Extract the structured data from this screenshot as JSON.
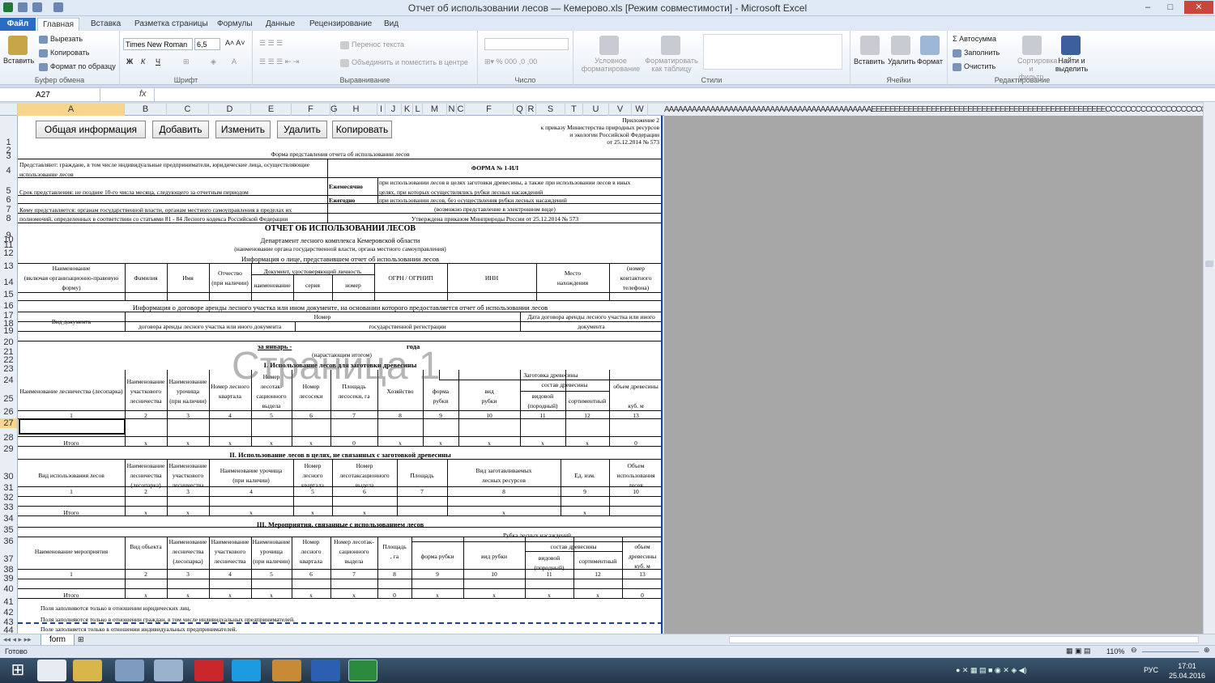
{
  "window": {
    "title": "Отчет об использовании лесов — Кемерово.xls  [Режим совместимости]  -  Microsoft Excel"
  },
  "tabs": [
    "Файл",
    "Главная",
    "Вставка",
    "Разметка страницы",
    "Формулы",
    "Данные",
    "Рецензирование",
    "Вид"
  ],
  "ribbon": {
    "clipboard": {
      "paste": "Вставить",
      "cut": "Вырезать",
      "copy": "Копировать",
      "format_painter": "Формат по образцу",
      "group": "Буфер обмена"
    },
    "font": {
      "name": "Times New Roman",
      "size": "6,5",
      "group": "Шрифт"
    },
    "alignment": {
      "wrap": "Перенос текста",
      "merge": "Объединить и поместить в центре",
      "group": "Выравнивание"
    },
    "number": {
      "group": "Число"
    },
    "styles": {
      "conditional": "Условное форматирование",
      "as_table": "Форматировать как таблицу",
      "group": "Стили"
    },
    "cells": {
      "insert": "Вставить",
      "delete": "Удалить",
      "format": "Формат",
      "group": "Ячейки"
    },
    "editing": {
      "autosum": "Автосумма",
      "fill": "Заполнить",
      "clear": "Очистить",
      "sort": "Сортировка и фильтр",
      "find": "Найти и выделить",
      "group": "Редактирование"
    }
  },
  "formula_bar": {
    "name_box": "A27",
    "fx": "fx",
    "value": ""
  },
  "columns": [
    "A",
    "B",
    "C",
    "D",
    "E",
    "F",
    "G",
    "H",
    "I",
    "J",
    "K",
    "L",
    "M",
    "N",
    "C",
    "F",
    "Q",
    "R",
    "S",
    "T",
    "U",
    "V",
    "W",
    "X"
  ],
  "hatch": "AAAAAAAAAAAAAAAAAAAAAAAAAAAAAAAAAAAAAAAAAAAAAEEEEEEEEEEEEEEEEEEEEEEEEEEEEEEEEEEEEEEEEEEEEEEEEEEECCCCCCCCCCCCCCCCCCCCCCCCCCCCCCCCCCCEEEEEEEEEEEEEEEEEEEEEEEEEEEEE",
  "rows": [
    "1",
    "2",
    "3",
    "4",
    "5",
    "6",
    "7",
    "8",
    "9",
    "10",
    "11",
    "12",
    "13",
    "14",
    "15",
    "16",
    "17",
    "18",
    "19",
    "20",
    "21",
    "22",
    "23",
    "24",
    "25",
    "26",
    "27",
    "28",
    "29",
    "30",
    "31",
    "32",
    "33",
    "34",
    "35",
    "36",
    "37",
    "38",
    "39",
    "40",
    "41",
    "42",
    "43",
    "44"
  ],
  "buttons": [
    "Общая информация",
    "Добавить",
    "Изменить",
    "Удалить",
    "Копировать"
  ],
  "header_right": [
    "Приложение 2",
    "к приказу Министерства природных ресурсов",
    "и экологии Российской Федерации",
    "от 25.12.2014 № 573"
  ],
  "form": {
    "r3": "Форма представления отчета об использовании лесов",
    "r4a": "Представляют: граждане, в том числе индивидуальные предприниматели, юридические лица, осуществляющие",
    "r4b": "использование лесов",
    "r4form": "ФОРМА № 1-ИЛ",
    "r5": "Срок представления: не позднее 10-го числа месяца, следующего за отчетным периодом",
    "monthly": "Ежемесячно",
    "monthly_txt1": "при использовании лесов в целях заготовки древесины, а также при использовании лесов в иных",
    "monthly_txt2": "целях, при которых осуществлялись рубки лесных насаждений",
    "yearly": "Ежегодно",
    "yearly_txt": "при использовании лесов, без осуществления рубки лесных насаждений",
    "electronic": "(возможно представление в электронном виде)",
    "r7a": "Кому представляется: органам государственной власти, органам местного самоуправления в пределах их",
    "r7b": "полномочий, определенных в соответствии со статьями 81 - 84 Лесного кодекса Российской Федерации",
    "approved": "Утверждена приказом Минприроды России от 25.12.2014 № 573",
    "report_title": "ОТЧЕТ ОБ ИСПОЛЬЗОВАНИИ ЛЕСОВ",
    "department": "Департамент лесного комплекса Кемеровской области",
    "authority_note": "(наименование органа государственной власти, органа местного самоуправления)",
    "person_info": "Информация о лице, представившем отчет об использовании лесов",
    "h_name": "Наименование",
    "h_name2": "(включая организационно-правовую",
    "h_name3": "форму)",
    "h_surname": "Фамилия",
    "h_firstname": "Имя",
    "h_patr": "Отчество",
    "h_patr2": "(при наличии)",
    "h_doc": "Документ, удостоверяющий личность",
    "h_docname": "наименование",
    "h_series": "серия",
    "h_number": "номер",
    "h_ogrn": "ОГРН / ОГРНИП",
    "h_inn": "ИНН",
    "h_loc": "Место",
    "h_loc2": "нахождения",
    "h_phone": "(номер",
    "h_phone2": "контактного",
    "h_phone3": "телефона)",
    "lease_info": "Информация о договоре аренды лесного участка или ином документе, на основании которого предоставляется отчет об использовании лесов",
    "doc_type": "Вид документа",
    "num": "Номер",
    "num_contract": "договора аренды лесного участка или иного документа",
    "num_reg": "государственной регистрации",
    "contract_date": "Дата договора аренды лесного участка или иного",
    "contract_date2": "документа",
    "period": "за январь -",
    "period_year": "года",
    "cumulative": "(нарастающим итогом)",
    "sec1": "I. Использование лесов для заготовки древесины",
    "harvest": "Заготовка древесины",
    "s1_h1": "Наименование лесничества (лесопарка)",
    "s1_h2a": "Наименование",
    "s1_h2b": "участкового",
    "s1_h2c": "лесничества",
    "s1_h3a": "Наименование",
    "s1_h3b": "урочища",
    "s1_h3c": "(при наличии)",
    "s1_h4a": "Номер лесного",
    "s1_h4b": "квартала",
    "s1_h5a": "Номер",
    "s1_h5b": "лесотак-",
    "s1_h5c": "сационного",
    "s1_h5d": "выдела",
    "s1_h6a": "Номер",
    "s1_h6b": "лесосеки",
    "s1_h7a": "Площадь",
    "s1_h7b": "лесосеки, га",
    "s1_h8": "Хозяйство",
    "s1_h9a": "форма",
    "s1_h9b": "рубки",
    "s1_h10a": "вид",
    "s1_h10b": "рубки",
    "s1_comp": "состав древесины",
    "s1_h11a": "видовой",
    "s1_h11b": "(породный)",
    "s1_h12": "сортиментный",
    "s1_h13a": "объем древесины",
    "s1_h13b": "куб. м",
    "s1_nums": [
      "1",
      "2",
      "3",
      "4",
      "5",
      "6",
      "7",
      "8",
      "9",
      "10",
      "11",
      "12",
      "13"
    ],
    "total": "Итого",
    "s1_total": [
      "x",
      "x",
      "x",
      "x",
      "x",
      "0",
      "x",
      "x",
      "x",
      "x",
      "x",
      "0"
    ],
    "sec2": "II. Использование лесов в целях, не связанных с заготовкой древесины",
    "s2_h1": "Вид использования лесов",
    "s2_h2a": "Наименование",
    "s2_h2b": "лесничества",
    "s2_h2c": "(лесопарка)",
    "s2_h3a": "Наименование",
    "s2_h3b": "участкового",
    "s2_h3c": "лесничества",
    "s2_h4a": "Наименование урочища",
    "s2_h4b": "(при наличии)",
    "s2_h5a": "Номер",
    "s2_h5b": "лесного",
    "s2_h5c": "квартала",
    "s2_h6a": "Номер",
    "s2_h6b": "лесотаксационного",
    "s2_h6c": "выдела",
    "s2_h7": "Площадь",
    "s2_h7u": ", га",
    "s2_h8a": "Вид заготавливаемых",
    "s2_h8b": "лесных ресурсов",
    "s2_h9": "Ед. изм.",
    "s2_h10a": "Объем",
    "s2_h10b": "использования",
    "s2_h10c": "лесов",
    "s2_nums": [
      "1",
      "2",
      "3",
      "4",
      "5",
      "6",
      "7",
      "8",
      "9",
      "10"
    ],
    "s2_total": [
      "x",
      "x",
      "x",
      "x",
      "x",
      "x",
      "x"
    ],
    "sec3": "III. Мероприятия, связанные с использованием лесов",
    "felling": "Рубка лесных насаждений",
    "s3_h1": "Наименование мероприятия",
    "s3_h2a": "Вид объекта",
    "s3_h3a": "Наименование",
    "s3_h3b": "лесничества",
    "s3_h3c": "(лесопарка)",
    "s3_h4a": "Наименование",
    "s3_h4b": "участкового",
    "s3_h4c": "лесничества",
    "s3_h5a": "Наименование",
    "s3_h5b": "урочища",
    "s3_h5c": "(при наличии)",
    "s3_h6a": "Номер",
    "s3_h6b": "лесного",
    "s3_h6c": "квартала",
    "s3_h7a": "Номер лесотак-",
    "s3_h7b": "сационного",
    "s3_h7c": "выдела",
    "s3_h8a": "Площадь",
    "s3_h8b": ", га",
    "s3_h9": "форма рубки",
    "s3_h10": "вид рубки",
    "s3_comp": "состав древесины",
    "s3_h11a": "видовой",
    "s3_h11b": "(породный)",
    "s3_h12": "сортиментный",
    "s3_h13a": "объем",
    "s3_h13b": "древесины",
    "s3_h13c": "куб. м",
    "s3_nums": [
      "1",
      "2",
      "3",
      "4",
      "5",
      "6",
      "7",
      "8",
      "9",
      "10",
      "11",
      "12",
      "13"
    ],
    "s3_total": [
      "x",
      "x",
      "x",
      "x",
      "x",
      "x",
      "0",
      "x",
      "x",
      "x",
      "x",
      "0"
    ],
    "fn1": "Поля заполняются только в отношении юридических лиц.",
    "fn2": "Поля заполняются только в отношении граждан, в том числе индивидуальных предпринимателей.",
    "fn3": "Поле заполняется только в отношении индивидуальных предпринимателей."
  },
  "watermark": "Страница 1",
  "sheet_tab": "form",
  "status": {
    "ready": "Готово",
    "zoom": "110%"
  },
  "taskbar": {
    "time": "17:01",
    "date": "25.04.2016",
    "lang": "РУС"
  }
}
